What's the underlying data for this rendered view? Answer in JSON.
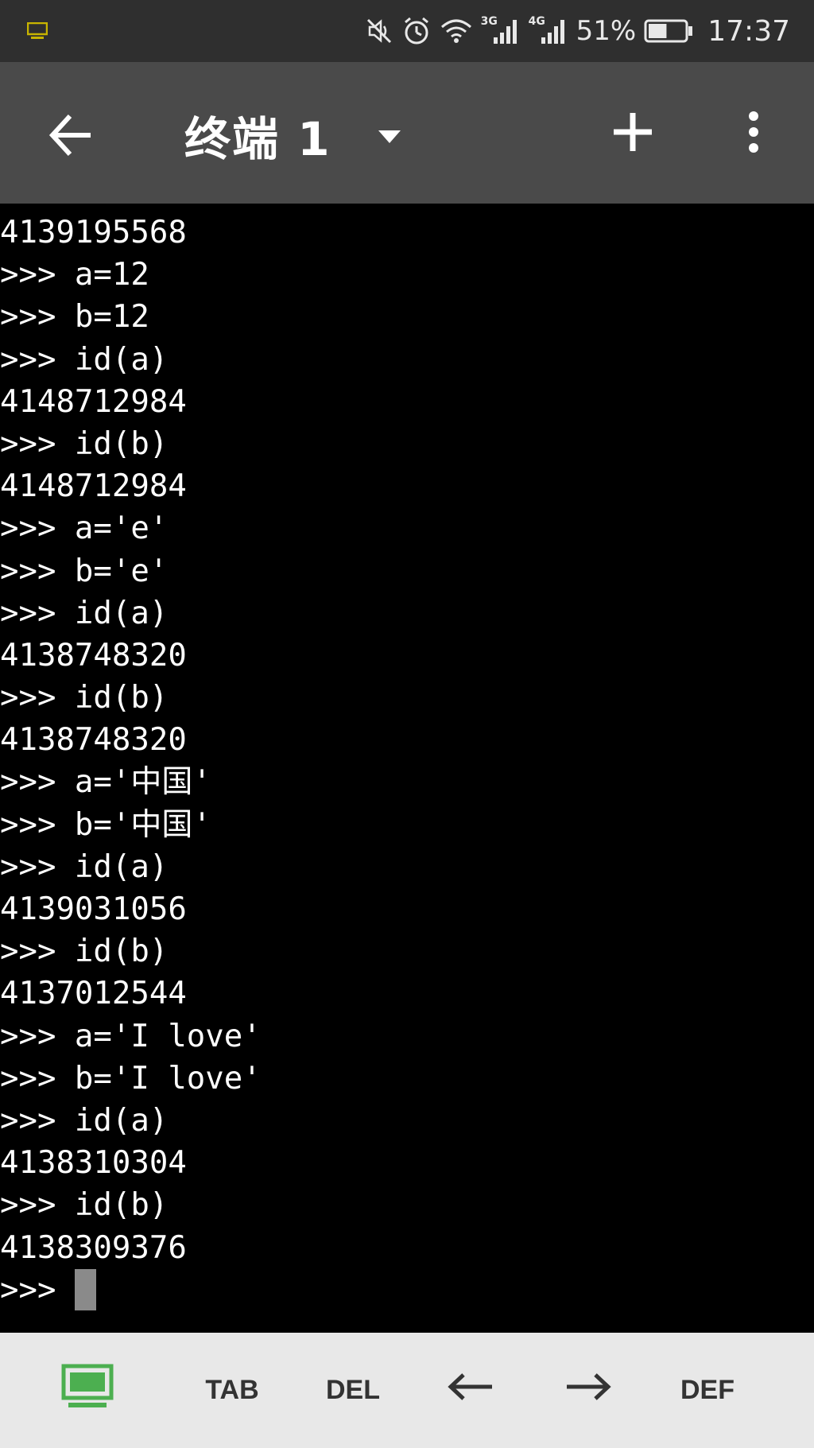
{
  "status_bar": {
    "icons": [
      "monitor-icon",
      "mute-icon",
      "alarm-icon",
      "wifi-icon",
      "signal-3g-icon",
      "signal-4g-icon",
      "battery-icon"
    ],
    "net1_label": "3G",
    "net2_label": "4G",
    "battery_percent": "51%",
    "battery_level": 0.51,
    "time": "17:37"
  },
  "app_bar": {
    "title": "终端 1",
    "icons": [
      "back-arrow-icon",
      "dropdown-caret-icon",
      "plus-icon",
      "more-vertical-icon"
    ]
  },
  "terminal": {
    "lines": [
      "4139195568",
      ">>> a=12",
      ">>> b=12",
      ">>> id(a)",
      "4148712984",
      ">>> id(b)",
      "4148712984",
      ">>> a='e'",
      ">>> b='e'",
      ">>> id(a)",
      "4138748320",
      ">>> id(b)",
      "4138748320",
      ">>> a='中国'",
      ">>> b='中国'",
      ">>> id(a)",
      "4139031056",
      ">>> id(b)",
      "4137012544",
      ">>> a='I love'",
      ">>> b='I love'",
      ">>> id(a)",
      "4138310304",
      ">>> id(b)",
      "4138309376"
    ],
    "prompt": ">>> "
  },
  "key_bar": {
    "keys": [
      "TAB",
      "DEL",
      "←",
      "→",
      "DEF"
    ],
    "colors": {
      "keyboard_icon": "#4caf50"
    }
  }
}
